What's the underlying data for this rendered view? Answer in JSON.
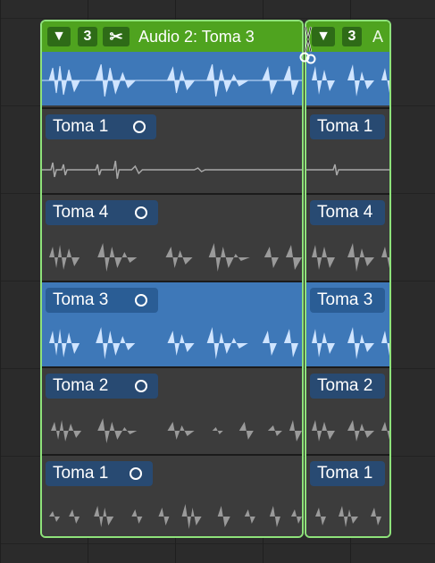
{
  "folder": {
    "header": {
      "disclosure_glyph": "▼",
      "takes_count": "3",
      "scissors_glyph": "✂",
      "title": "Audio 2: Toma 3",
      "right_title_fragment": "A"
    },
    "lanes": [
      {
        "label": "Toma 1",
        "active": false,
        "right_label": "Toma 1"
      },
      {
        "label": "Toma 4",
        "active": false,
        "right_label": "Toma 4"
      },
      {
        "label": "Toma 3",
        "active": true,
        "right_label": "Toma 3"
      },
      {
        "label": "Toma 2",
        "active": false,
        "right_label": "Toma 2"
      },
      {
        "label": "Toma 1",
        "active": false,
        "right_label": "Toma 1"
      }
    ]
  },
  "colors": {
    "folder_border": "#8ee27a",
    "header_green": "#4fa31f",
    "active_blue": "#3e78b8",
    "inactive_gray": "#3c3c3c",
    "wave_gray": "#9a9a9a",
    "wave_blue": "#cfe4ff"
  },
  "icons": {
    "disclosure": "disclosure-triangle-icon",
    "scissors": "scissors-icon",
    "cursor": "scissors-cursor-icon",
    "take_circle": "take-circle-icon"
  }
}
